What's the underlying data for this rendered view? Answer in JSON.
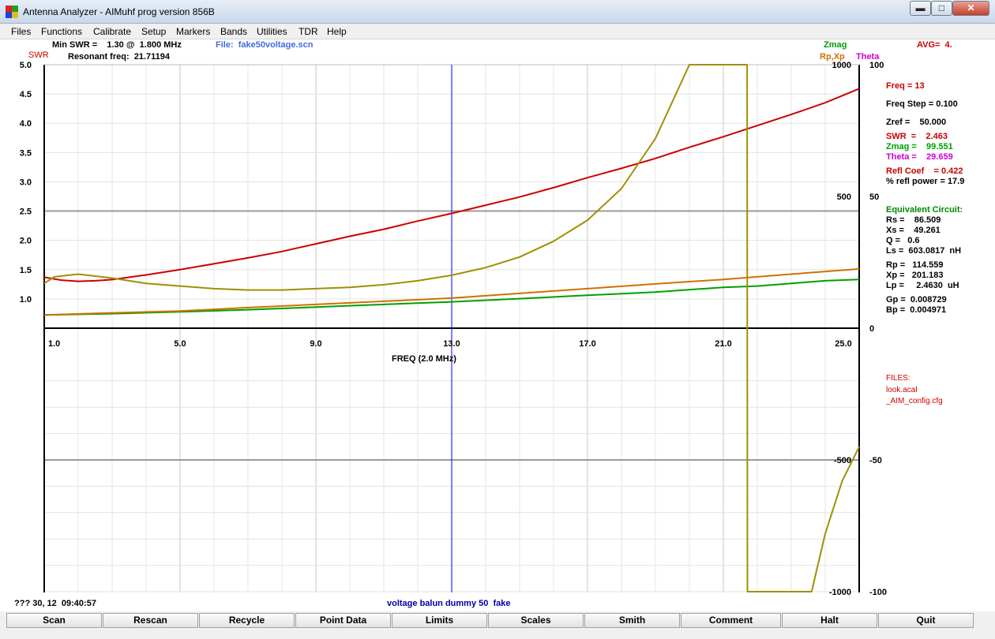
{
  "window": {
    "title": "Antenna Analyzer - AIMuhf   prog version 856B",
    "buttons": {
      "minimize": "▬",
      "maximize": "□",
      "close": "✕"
    }
  },
  "menu": [
    "Files",
    "Functions",
    "Calibrate",
    "Setup",
    "Markers",
    "Bands",
    "Utilities",
    "TDR",
    "Help"
  ],
  "header": {
    "min_swr": "Min SWR =    1.30 @  1.800 MHz",
    "resonant": "Resonant freq:  21.71194",
    "file": "File:  fake50voltage.scn",
    "swr_axis_label": "SWR",
    "zmag_label": "Zmag",
    "rpxp_label": "Rp,Xp",
    "theta_label": "Theta",
    "avg": "AVG=  4."
  },
  "readout": {
    "freq": "Freq = 13",
    "freq_step": "Freq Step = 0.100",
    "zref": "Zref =    50.000",
    "swr": "SWR  =    2.463",
    "zmag": "Zmag =    99.551",
    "theta": "Theta =    29.659",
    "refl_coef": "Refl Coef    = 0.422",
    "refl_power": "% refl power = 17.9",
    "eq_title": "Equivalent Circuit:",
    "rs": "Rs =    86.509",
    "xs": "Xs =    49.261",
    "q": "Q =   0.6",
    "ls": "Ls =  603.0817  nH",
    "rp": "Rp =   114.559",
    "xp": "Xp =   201.183",
    "lp": "Lp =     2.4630  uH",
    "gp": "Gp =  0.008729",
    "bp": "Bp =  0.004971",
    "files_title": "FILES:",
    "file1": "look.acal",
    "file2": "_AIM_config.cfg"
  },
  "status": {
    "left": "??? 30, 12  09:40:57",
    "center": "voltage balun dummy 50  fake"
  },
  "buttons": [
    "Scan",
    "Rescan",
    "Recycle",
    "Point Data",
    "Limits",
    "Scales",
    "Smith",
    "Comment",
    "Halt",
    "Quit"
  ],
  "colors": {
    "swr": "#cc0000",
    "zmag": "#00a000",
    "rp": "#d07000",
    "xp": "#a09000",
    "theta": "#cc00cc",
    "marker": "#0000ff",
    "file_label": "#4169e1",
    "status_center": "#0000aa",
    "eq": "#008800"
  },
  "chart_data": {
    "type": "line",
    "xlabel": "FREQ (2.0 MHz)",
    "x_ticks": [
      "1.0",
      "5.0",
      "9.0",
      "13.0",
      "17.0",
      "21.0",
      "25.0"
    ],
    "xlim": [
      1.0,
      25.0
    ],
    "swr_ticks": [
      "5.0",
      "4.5",
      "4.0",
      "3.5",
      "3.0",
      "2.5",
      "2.0",
      "1.5",
      "1.0"
    ],
    "swr_ylim": [
      0.5,
      5.0
    ],
    "ohm_ticks": [
      "1000",
      "500",
      "-500",
      "-1000"
    ],
    "ohm_ylim": [
      -1000,
      1000
    ],
    "theta_ticks": [
      "100",
      "50",
      "0",
      "-50",
      "-100"
    ],
    "theta_ylim": [
      -100,
      100
    ],
    "marker_freq": 13.0,
    "series": [
      {
        "name": "SWR",
        "axis": "swr",
        "x": [
          1.0,
          1.5,
          2.0,
          2.5,
          3.0,
          4.0,
          5.0,
          6.0,
          7.0,
          8.0,
          9.0,
          10.0,
          11.0,
          12.0,
          13.0,
          14.0,
          15.0,
          16.0,
          17.0,
          18.0,
          19.0,
          20.0,
          21.0,
          22.0,
          23.0,
          24.0,
          25.0
        ],
        "y": [
          1.37,
          1.32,
          1.3,
          1.31,
          1.33,
          1.41,
          1.5,
          1.6,
          1.7,
          1.81,
          1.94,
          2.07,
          2.19,
          2.33,
          2.46,
          2.6,
          2.74,
          2.9,
          3.07,
          3.23,
          3.4,
          3.59,
          3.77,
          3.96,
          4.15,
          4.35,
          4.59
        ]
      },
      {
        "name": "Zmag",
        "axis": "ohm",
        "x": [
          1.0,
          3.0,
          5.0,
          7.0,
          9.0,
          11.0,
          13.0,
          15.0,
          17.0,
          19.0,
          21.0,
          22.0,
          23.0,
          24.0,
          25.0
        ],
        "y": [
          50,
          55,
          62,
          70,
          80,
          90,
          100,
          112,
          125,
          137,
          155,
          160,
          170,
          180,
          185
        ]
      },
      {
        "name": "Rp",
        "axis": "ohm",
        "x": [
          1.0,
          3.0,
          5.0,
          7.0,
          9.0,
          11.0,
          13.0,
          15.0,
          17.0,
          19.0,
          21.0,
          23.0,
          25.0
        ],
        "y": [
          50,
          58,
          65,
          78,
          90,
          102,
          114,
          132,
          150,
          168,
          185,
          205,
          225
        ]
      },
      {
        "name": "Xp",
        "axis": "ohm",
        "x": [
          1.0,
          1.3,
          2.0,
          3.0,
          4.0,
          5.0,
          6.0,
          7.0,
          8.0,
          9.0,
          10.0,
          11.0,
          12.0,
          13.0,
          14.0,
          15.0,
          16.0,
          17.0,
          18.0,
          19.0,
          19.5,
          20.0,
          20.3,
          21.0,
          21.7,
          21.71,
          22.0,
          23.0,
          23.3,
          23.6,
          24.0,
          24.5,
          25.0
        ],
        "y": [
          170,
          195,
          205,
          190,
          170,
          160,
          150,
          145,
          145,
          150,
          155,
          165,
          180,
          201,
          230,
          270,
          330,
          410,
          530,
          720,
          860,
          1000,
          1000,
          1000,
          1000,
          -1000,
          -1000,
          -1000,
          -1000,
          -1000,
          -780,
          -580,
          -450
        ]
      }
    ]
  }
}
